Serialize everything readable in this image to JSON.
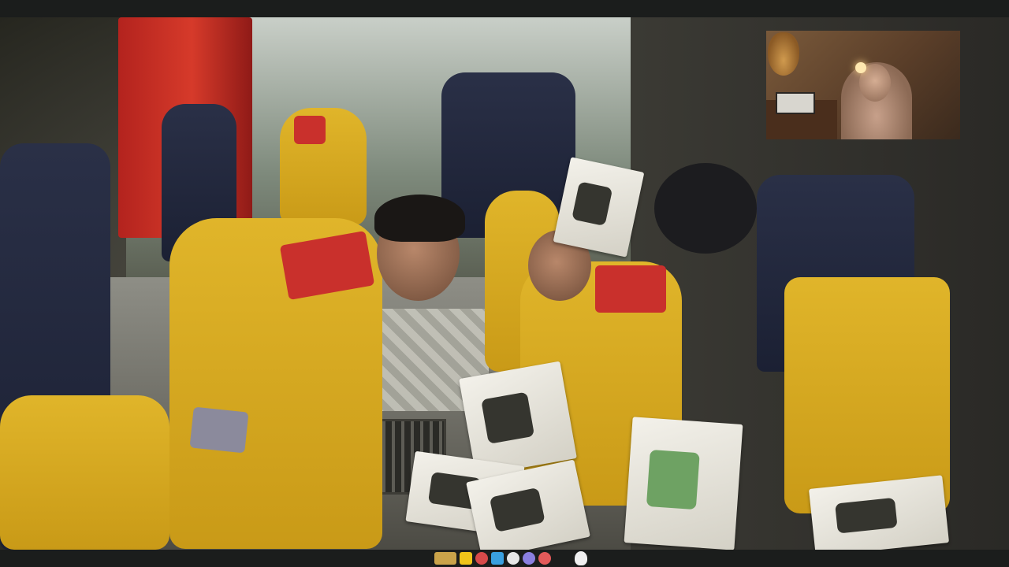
{
  "stream": {
    "scene": "video",
    "webcam_overlay": true
  },
  "sponsor_bar": {
    "logos": [
      {
        "icon": "crown-sponsor-logo"
      },
      {
        "icon": "boot-sponsor-logo"
      },
      {
        "icon": "red-circle-sponsor-logo"
      },
      {
        "icon": "blue-cube-sponsor-logo"
      },
      {
        "icon": "swirl-sponsor-logo"
      },
      {
        "icon": "violet-sponsor-logo"
      },
      {
        "icon": "redwhite-sponsor-logo"
      },
      {
        "icon": "text-sponsor-logo"
      },
      {
        "icon": "ghost-sponsor-logo"
      }
    ]
  },
  "colors": {
    "frame_background": "#1c1e1d",
    "rescue_uniform": "#e0b52a",
    "rescue_patch": "#c9302c",
    "navy_shirt": "#2a3047"
  }
}
